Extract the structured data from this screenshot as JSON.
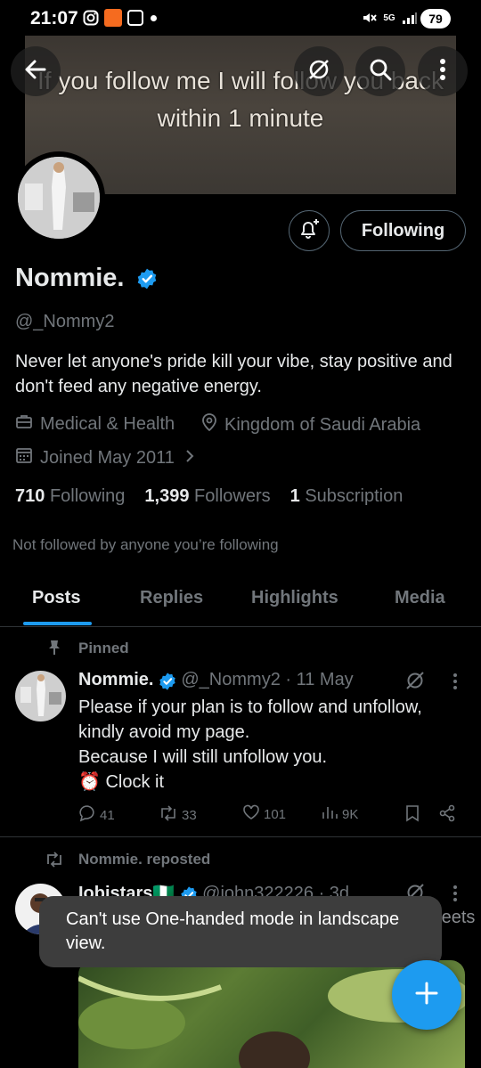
{
  "status_bar": {
    "time": "21:07",
    "battery": "79",
    "network": "5G"
  },
  "banner": {
    "text": "If you follow me I will follow you back within 1 minute"
  },
  "profile": {
    "name": "Nommie.",
    "handle": "@_Nommy2",
    "bio": "Never let anyone's pride kill your vibe, stay positive and don't feed any negative energy.",
    "category": "Medical & Health",
    "location": "Kingdom of Saudi Arabia",
    "joined": "Joined May 2011",
    "following_count": "710",
    "following_label": "Following",
    "followers_count": "1,399",
    "followers_label": "Followers",
    "subscription_count": "1",
    "subscription_label": "Subscription",
    "not_followed_text": "Not followed by anyone you’re following",
    "follow_button_label": "Following"
  },
  "tabs": [
    {
      "label": "Posts",
      "active": true
    },
    {
      "label": "Replies",
      "active": false
    },
    {
      "label": "Highlights",
      "active": false
    },
    {
      "label": "Media",
      "active": false
    }
  ],
  "pinned_tweet": {
    "pinned_label": "Pinned",
    "author": "Nommie.",
    "handle_date": "@_Nommy2 · 11 May",
    "lines": [
      "Please if your plan is to follow and unfollow, kindly avoid my page.",
      "Because I will still unfollow you.",
      "⏰ Clock it"
    ],
    "replies": "41",
    "retweets": "33",
    "likes": "101",
    "views": "9K"
  },
  "repost": {
    "repost_label": "Nommie. reposted",
    "author": "Iobistars🇳🇬",
    "handle_date": "@john322226 · 3d",
    "partial_text": "eact to tweets"
  },
  "toast": {
    "text": "Can't use One-handed mode in landscape view."
  },
  "colors": {
    "accent": "#1d9bf0",
    "background": "#000000",
    "muted": "#71767b",
    "text": "#e7e9ea"
  }
}
